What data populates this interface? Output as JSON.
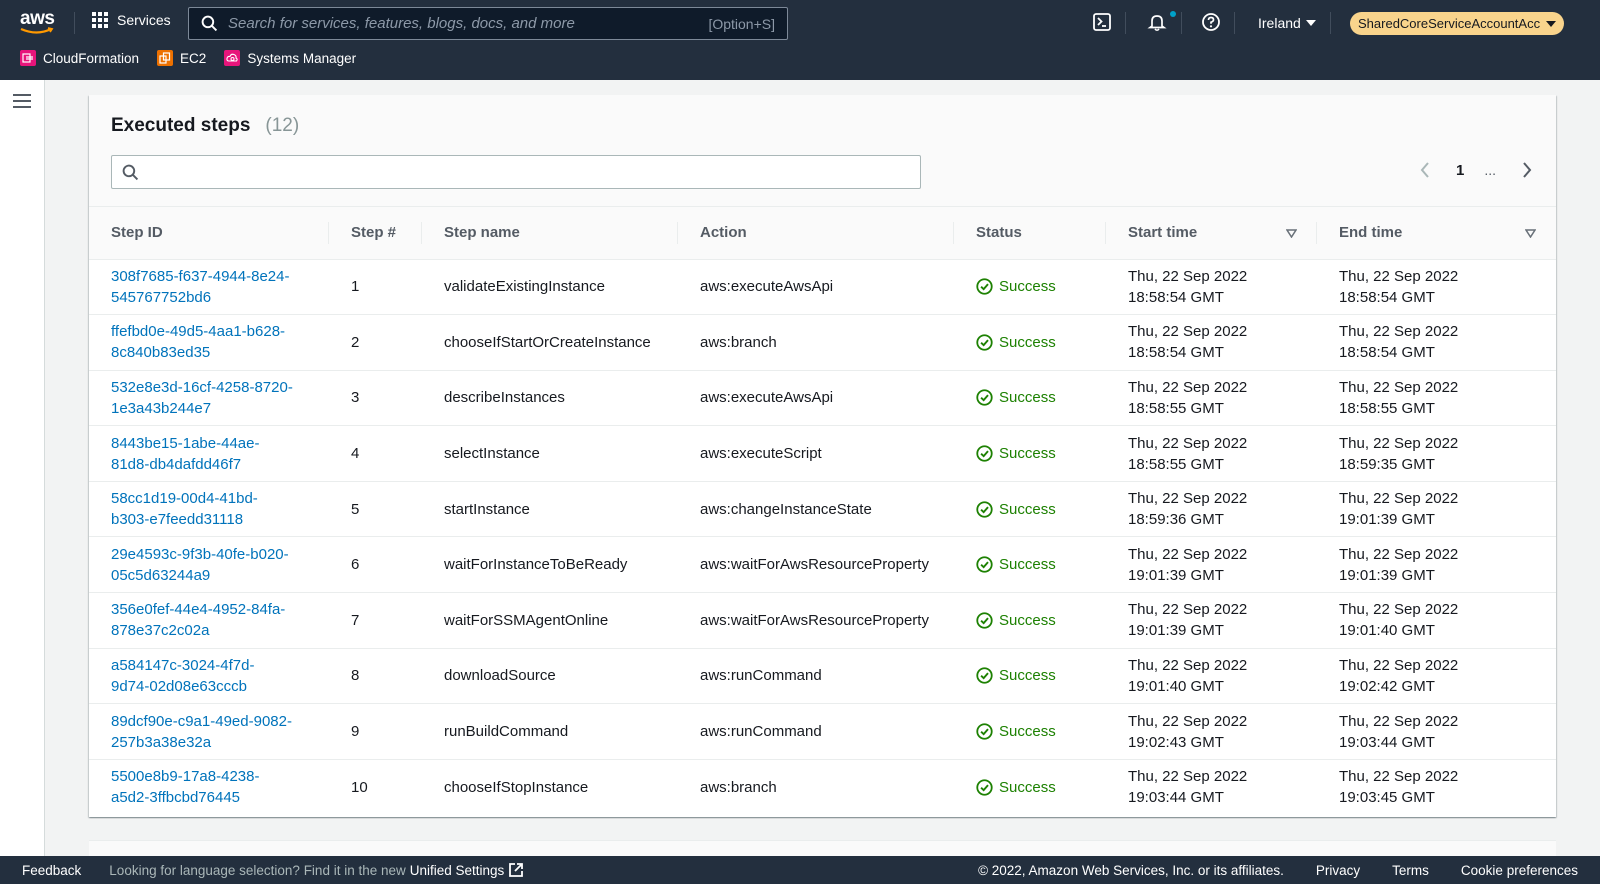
{
  "topnav": {
    "logo_text": "aws",
    "services_label": "Services",
    "search_placeholder": "Search for services, features, blogs, docs, and more",
    "search_shortcut": "[Option+S]",
    "region": "Ireland",
    "account": "SharedCoreServiceAccountAcces...",
    "favorites": [
      {
        "label": "CloudFormation",
        "color": "#e7157b"
      },
      {
        "label": "EC2",
        "color": "#ed7100"
      },
      {
        "label": "Systems Manager",
        "color": "#e7157b"
      }
    ]
  },
  "panel": {
    "title": "Executed steps",
    "count": "(12)",
    "filter_value": "",
    "pagination": {
      "current_page": "1",
      "ellipsis": "..."
    },
    "columns": [
      "Step ID",
      "Step #",
      "Step name",
      "Action",
      "Status",
      "Start time",
      "End time"
    ],
    "rows": [
      {
        "id_line1": "308f7685-f637-4944-8e24-",
        "id_line2": "545767752bd6",
        "num": "1",
        "name": "validateExistingInstance",
        "action": "aws:executeAwsApi",
        "status": "Success",
        "start_date": "Thu, 22 Sep 2022",
        "start_time": "18:58:54 GMT",
        "end_date": "Thu, 22 Sep 2022",
        "end_time": "18:58:54 GMT"
      },
      {
        "id_line1": "ffefbd0e-49d5-4aa1-b628-",
        "id_line2": "8c840b83ed35",
        "num": "2",
        "name": "chooseIfStartOrCreateInstance",
        "action": "aws:branch",
        "status": "Success",
        "start_date": "Thu, 22 Sep 2022",
        "start_time": "18:58:54 GMT",
        "end_date": "Thu, 22 Sep 2022",
        "end_time": "18:58:54 GMT"
      },
      {
        "id_line1": "532e8e3d-16cf-4258-8720-",
        "id_line2": "1e3a43b244e7",
        "num": "3",
        "name": "describeInstances",
        "action": "aws:executeAwsApi",
        "status": "Success",
        "start_date": "Thu, 22 Sep 2022",
        "start_time": "18:58:55 GMT",
        "end_date": "Thu, 22 Sep 2022",
        "end_time": "18:58:55 GMT"
      },
      {
        "id_line1": "8443be15-1abe-44ae-",
        "id_line2": "81d8-db4dafdd46f7",
        "num": "4",
        "name": "selectInstance",
        "action": "aws:executeScript",
        "status": "Success",
        "start_date": "Thu, 22 Sep 2022",
        "start_time": "18:58:55 GMT",
        "end_date": "Thu, 22 Sep 2022",
        "end_time": "18:59:35 GMT"
      },
      {
        "id_line1": "58cc1d19-00d4-41bd-",
        "id_line2": "b303-e7feedd31118",
        "num": "5",
        "name": "startInstance",
        "action": "aws:changeInstanceState",
        "status": "Success",
        "start_date": "Thu, 22 Sep 2022",
        "start_time": "18:59:36 GMT",
        "end_date": "Thu, 22 Sep 2022",
        "end_time": "19:01:39 GMT"
      },
      {
        "id_line1": "29e4593c-9f3b-40fe-b020-",
        "id_line2": "05c5d63244a9",
        "num": "6",
        "name": "waitForInstanceToBeReady",
        "action": "aws:waitForAwsResourceProperty",
        "status": "Success",
        "start_date": "Thu, 22 Sep 2022",
        "start_time": "19:01:39 GMT",
        "end_date": "Thu, 22 Sep 2022",
        "end_time": "19:01:39 GMT"
      },
      {
        "id_line1": "356e0fef-44e4-4952-84fa-",
        "id_line2": "878e37c2c02a",
        "num": "7",
        "name": "waitForSSMAgentOnline",
        "action": "aws:waitForAwsResourceProperty",
        "status": "Success",
        "start_date": "Thu, 22 Sep 2022",
        "start_time": "19:01:39 GMT",
        "end_date": "Thu, 22 Sep 2022",
        "end_time": "19:01:40 GMT"
      },
      {
        "id_line1": "a584147c-3024-4f7d-",
        "id_line2": "9d74-02d08e63cccb",
        "num": "8",
        "name": "downloadSource",
        "action": "aws:runCommand",
        "status": "Success",
        "start_date": "Thu, 22 Sep 2022",
        "start_time": "19:01:40 GMT",
        "end_date": "Thu, 22 Sep 2022",
        "end_time": "19:02:42 GMT"
      },
      {
        "id_line1": "89dcf90e-c9a1-49ed-9082-",
        "id_line2": "257b3a38e32a",
        "num": "9",
        "name": "runBuildCommand",
        "action": "aws:runCommand",
        "status": "Success",
        "start_date": "Thu, 22 Sep 2022",
        "start_time": "19:02:43 GMT",
        "end_date": "Thu, 22 Sep 2022",
        "end_time": "19:03:44 GMT"
      },
      {
        "id_line1": "5500e8b9-17a8-4238-",
        "id_line2": "a5d2-3ffbcbd76445",
        "num": "10",
        "name": "chooseIfStopInstance",
        "action": "aws:branch",
        "status": "Success",
        "start_date": "Thu, 22 Sep 2022",
        "start_time": "19:03:44 GMT",
        "end_date": "Thu, 22 Sep 2022",
        "end_time": "19:03:45 GMT"
      }
    ]
  },
  "footer": {
    "feedback": "Feedback",
    "language_prompt": "Looking for language selection? Find it in the new",
    "unified_settings": "Unified Settings",
    "copyright": "© 2022, Amazon Web Services, Inc. or its affiliates.",
    "privacy": "Privacy",
    "terms": "Terms",
    "cookie": "Cookie preferences"
  },
  "colors": {
    "nav_bg": "#232f3e",
    "link": "#0073bb",
    "success": "#1d8102",
    "account_badge": "#f9d48c"
  }
}
